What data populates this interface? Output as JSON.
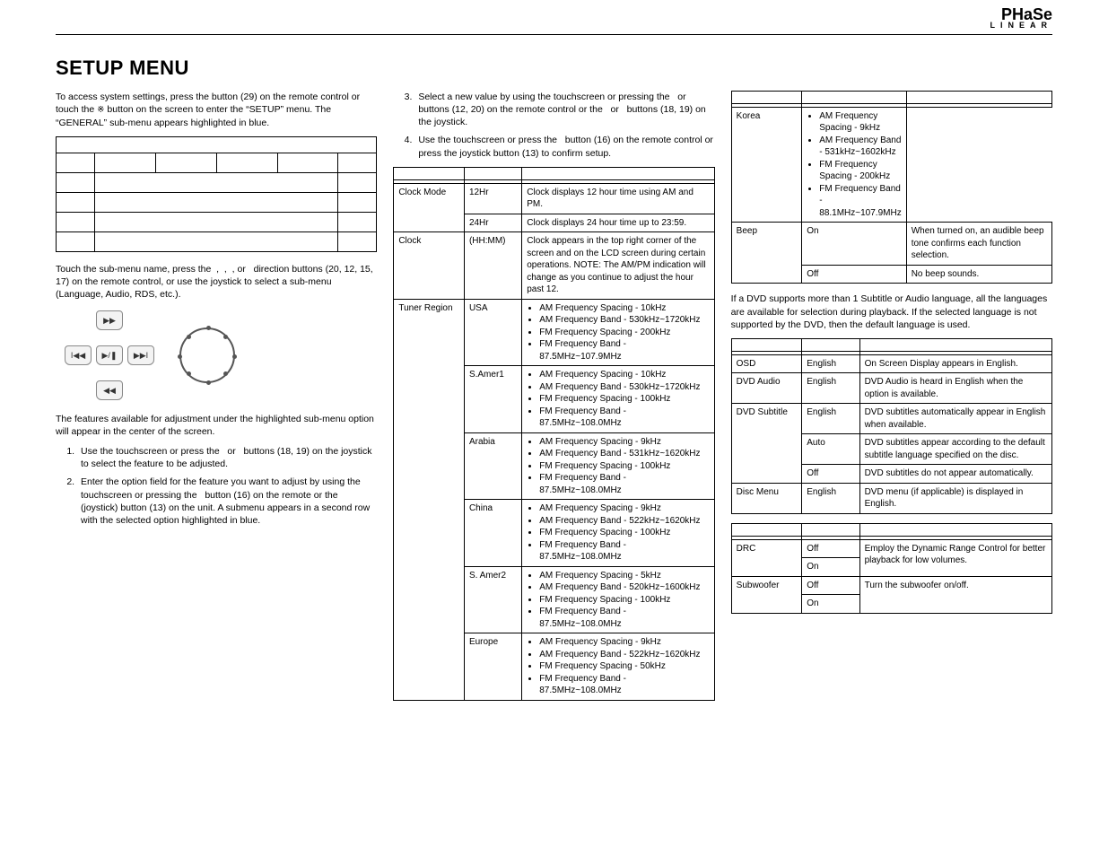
{
  "brand": {
    "line1": "PHaSe",
    "line2": "LINEAR"
  },
  "title": "SETUP MENU",
  "col1": {
    "p1a": "To access system settings, press the ",
    "p1b": " button (29) on the remote control or touch the ",
    "p1c": " button on the screen to enter the “SETUP” menu. The “GENERAL” sub-menu appears highlighted in blue.",
    "p2": "Touch the sub-menu name, press the  ,  ,  , or   direction buttons (20, 12, 15, 17) on the remote control, or use the joystick to select a sub-menu (Language, Audio, RDS, etc.).",
    "p3": "The features available for adjustment under the highlighted sub-menu option will appear in the center of the screen.",
    "li1": "Use the touchscreen or press the   or   buttons (18, 19) on the joystick to select the feature to be adjusted.",
    "li2": "Enter the option field for the feature you want to adjust by using the touchscreen or pressing the   button (16) on the remote or the     (joystick) button (13) on the unit. A submenu appears in a second row with the selected option highlighted in blue."
  },
  "col2": {
    "li3": "Select a new value by using the touchscreen or pressing the   or   buttons (12, 20) on the remote control or the   or   buttons (18, 19) on the joystick.",
    "li4": "Use the touchscreen or press the   button (16) on the remote control or press the joystick button (13) to confirm setup.",
    "table": [
      {
        "f": "Clock Mode",
        "o": "12Hr",
        "d": "Clock displays 12 hour time using AM and PM."
      },
      {
        "f": "",
        "o": "24Hr",
        "d": "Clock displays 24 hour time up to 23:59."
      },
      {
        "f": "Clock",
        "o": "(HH:MM)",
        "d": "Clock appears in the top right corner of the screen and on the LCD screen during certain operations. NOTE: The AM/PM indication will change as you continue to adjust the hour past 12."
      },
      {
        "f": "Tuner Region",
        "o": "USA",
        "d": [
          "AM Frequency Spacing - 10kHz",
          "AM Frequency Band - 530kHz~1720kHz",
          "FM Frequency Spacing - 200kHz",
          "FM Frequency Band - 87.5MHz~107.9MHz"
        ]
      },
      {
        "f": "",
        "o": "S.Amer1",
        "d": [
          "AM Frequency Spacing - 10kHz",
          "AM Frequency Band - 530kHz~1720kHz",
          "FM Frequency Spacing - 100kHz",
          "FM Frequency Band - 87.5MHz~108.0MHz"
        ]
      },
      {
        "f": "",
        "o": "Arabia",
        "d": [
          "AM Frequency Spacing - 9kHz",
          "AM Frequency Band - 531kHz~1620kHz",
          "FM Frequency Spacing - 100kHz",
          "FM Frequency Band - 87.5MHz~108.0MHz"
        ]
      },
      {
        "f": "",
        "o": "China",
        "d": [
          "AM Frequency Spacing - 9kHz",
          "AM Frequency Band - 522kHz~1620kHz",
          "FM Frequency Spacing - 100kHz",
          "FM Frequency Band - 87.5MHz~108.0MHz"
        ]
      },
      {
        "f": "",
        "o": "S. Amer2",
        "d": [
          "AM Frequency Spacing - 5kHz",
          "AM Frequency Band - 520kHz~1600kHz",
          "FM Frequency Spacing - 100kHz",
          "FM Frequency Band - 87.5MHz~108.0MHz"
        ]
      },
      {
        "f": "",
        "o": "Europe",
        "d": [
          "AM Frequency Spacing - 9kHz",
          "AM Frequency Band - 522kHz~1620kHz",
          "FM Frequency Spacing - 50kHz",
          "FM Frequency Band - 87.5MHz~108.0MHz"
        ]
      }
    ]
  },
  "col3": {
    "tableA": [
      {
        "f": "",
        "o": "Korea",
        "d": [
          "AM Frequency Spacing - 9kHz",
          "AM Frequency Band - 531kHz~1602kHz",
          "FM Frequency Spacing - 200kHz",
          "FM Frequency Band - 88.1MHz~107.9MHz"
        ]
      },
      {
        "f": "Beep",
        "o": "On",
        "d": "When turned on, an audible beep tone confirms each function selection."
      },
      {
        "f": "",
        "o": "Off",
        "d": "No beep sounds."
      }
    ],
    "pLang": "If a DVD supports more than 1 Subtitle or Audio language, all the languages are available for selection during playback. If the selected language is not supported by the DVD, then the default language is used.",
    "tableB": [
      {
        "f": "OSD",
        "o": "English",
        "d": "On Screen Display appears in English."
      },
      {
        "f": "DVD Audio",
        "o": "English",
        "d": "DVD Audio is heard in English when the option is available."
      },
      {
        "f": "DVD Subtitle",
        "o": "English",
        "d": "DVD subtitles automatically appear in English when available."
      },
      {
        "f": "",
        "o": "Auto",
        "d": "DVD subtitles appear according to the default subtitle language specified on the disc."
      },
      {
        "f": "",
        "o": "Off",
        "d": "DVD subtitles do not appear automatically."
      },
      {
        "f": "Disc Menu",
        "o": "English",
        "d": "DVD menu (if applicable) is displayed in English."
      }
    ],
    "tableC": [
      {
        "f": "DRC",
        "o": "Off",
        "d": "Employ the Dynamic Range Control for better playback for low volumes.",
        "rowspan_d": 2
      },
      {
        "f": "",
        "o": "On",
        "d": ""
      },
      {
        "f": "Subwoofer",
        "o": "Off",
        "d": "Turn the subwoofer on/off.",
        "rowspan_d": 2
      },
      {
        "f": "",
        "o": "On",
        "d": ""
      }
    ]
  }
}
